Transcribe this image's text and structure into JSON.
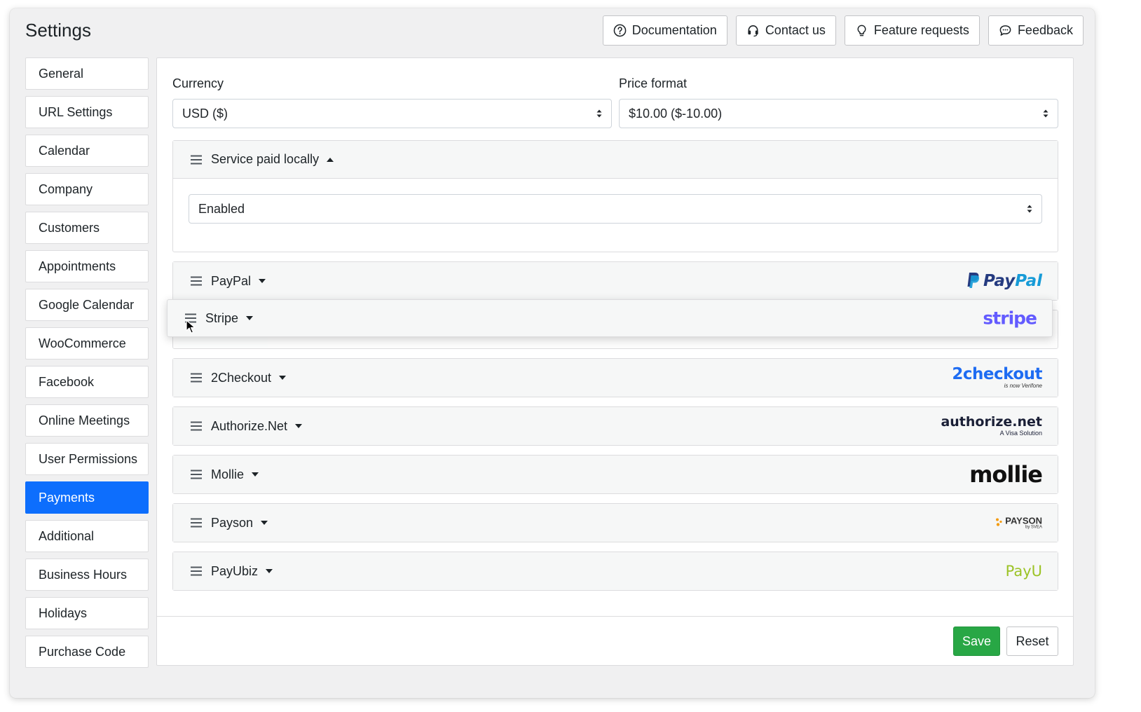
{
  "title": "Settings",
  "top_buttons": [
    {
      "label": "Documentation",
      "icon": "question-circle-icon"
    },
    {
      "label": "Contact us",
      "icon": "headset-icon"
    },
    {
      "label": "Feature requests",
      "icon": "lightbulb-icon"
    },
    {
      "label": "Feedback",
      "icon": "chat-icon"
    }
  ],
  "sidebar": {
    "active": "Payments",
    "items": [
      {
        "label": "General"
      },
      {
        "label": "URL Settings"
      },
      {
        "label": "Calendar"
      },
      {
        "label": "Company"
      },
      {
        "label": "Customers"
      },
      {
        "label": "Appointments"
      },
      {
        "label": "Google Calendar"
      },
      {
        "label": "WooCommerce"
      },
      {
        "label": "Facebook"
      },
      {
        "label": "Online Meetings"
      },
      {
        "label": "User Permissions"
      },
      {
        "label": "Payments"
      },
      {
        "label": "Additional"
      },
      {
        "label": "Business Hours"
      },
      {
        "label": "Holidays"
      },
      {
        "label": "Purchase Code"
      }
    ]
  },
  "currency": {
    "label": "Currency",
    "value": "USD ($)"
  },
  "price_format": {
    "label": "Price format",
    "value": "$10.00 ($-10.00)"
  },
  "service_paid_locally": {
    "title": "Service paid locally",
    "status": "Enabled",
    "expanded": true
  },
  "gateways": [
    {
      "name": "PayPal",
      "logo_text": "PayPal",
      "logo_color": "#253b80"
    },
    {
      "name": "2Checkout",
      "logo_text": "2checkout",
      "logo_sub": "is now Verifone",
      "logo_color": "#1e6cf2"
    },
    {
      "name": "Authorize.Net",
      "logo_text": "authorize.net",
      "logo_sub": "A Visa Solution",
      "logo_color": "#1a1f36"
    },
    {
      "name": "Mollie",
      "logo_text": "mollie",
      "logo_color": "#111111"
    },
    {
      "name": "Payson",
      "logo_text": "PAYSON",
      "logo_sub": "by SVEA",
      "logo_color": "#333333"
    },
    {
      "name": "PayUbiz",
      "logo_text": "PayU",
      "logo_color": "#9cc326"
    }
  ],
  "dragging": {
    "name": "Stripe",
    "logo_text": "stripe",
    "logo_color": "#635bff"
  },
  "actions": {
    "save": "Save",
    "reset": "Reset"
  },
  "colors": {
    "accent": "#0d6efd",
    "save": "#28a745"
  }
}
